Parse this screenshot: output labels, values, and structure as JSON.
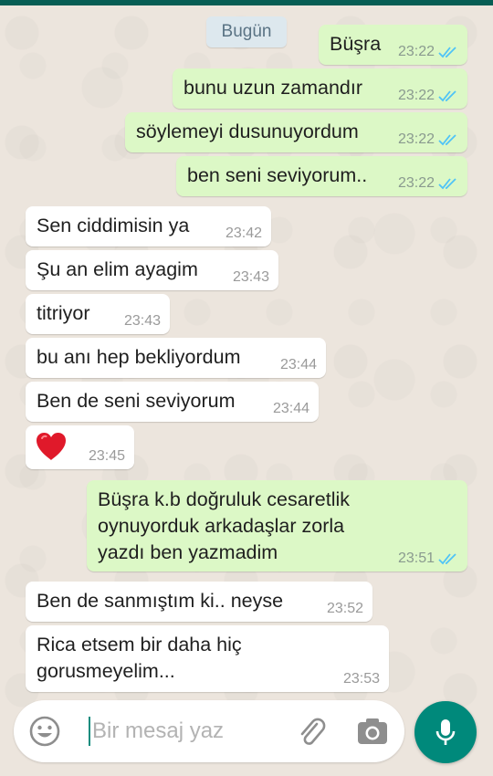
{
  "day_label": "Bugün",
  "messages": [
    {
      "dir": "out",
      "text": "Büşra",
      "time": "23:22",
      "read": true
    },
    {
      "dir": "out",
      "text": "bunu uzun zamandır",
      "time": "23:22",
      "read": true
    },
    {
      "dir": "out",
      "text": "söylemeyi dusunuyordum",
      "time": "23:22",
      "read": true
    },
    {
      "dir": "out",
      "text": "ben seni seviyorum..",
      "time": "23:22",
      "read": true
    },
    {
      "dir": "in",
      "text": "Sen ciddimisin ya",
      "time": "23:42"
    },
    {
      "dir": "in",
      "text": "Şu an elim ayagim",
      "time": "23:43"
    },
    {
      "dir": "in",
      "text": "titriyor",
      "time": "23:43"
    },
    {
      "dir": "in",
      "text": "bu anı hep bekliyordum",
      "time": "23:44"
    },
    {
      "dir": "in",
      "text": "Ben de seni seviyorum",
      "time": "23:44"
    },
    {
      "dir": "in",
      "text": "",
      "emoji": "red-heart",
      "time": "23:45"
    },
    {
      "dir": "out",
      "text": "Büşra k.b doğruluk cesaretlik oynuyorduk arkadaşlar zorla yazdı ben yazmadim",
      "time": "23:51",
      "read": true
    },
    {
      "dir": "in",
      "text": "Ben de sanmıştım ki.. neyse",
      "time": "23:52"
    },
    {
      "dir": "in",
      "text": "Rica etsem bir daha hiç gorusmeyelim...",
      "time": "23:53"
    }
  ],
  "composer": {
    "placeholder": "Bir mesaj yaz",
    "icons": [
      "emoji-icon",
      "attach-icon",
      "camera-icon",
      "mic-icon"
    ]
  },
  "colors": {
    "outgoing_bubble": "#dcf8c6",
    "incoming_bubble": "#ffffff",
    "read_ticks": "#4fc3f7",
    "accent": "#00897b",
    "header": "#075e54"
  }
}
